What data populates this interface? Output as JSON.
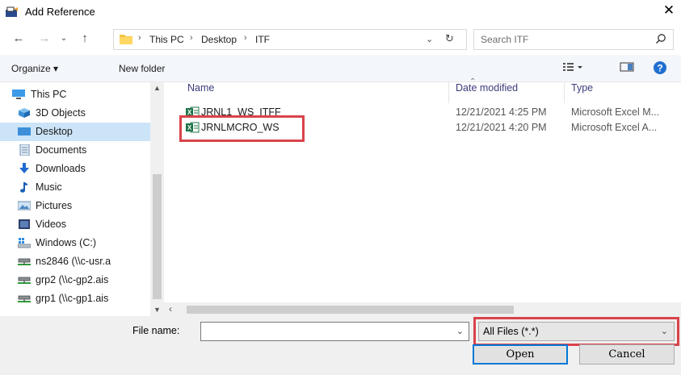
{
  "window": {
    "title": "Add Reference",
    "close": "✕"
  },
  "address": {
    "crumbs": [
      "This PC",
      "Desktop",
      "ITF"
    ],
    "search_placeholder": "Search ITF"
  },
  "toolbar": {
    "organize": "Organize ▾",
    "new_folder": "New folder"
  },
  "sidebar": {
    "items": [
      {
        "label": "This PC",
        "icon": "computer-icon"
      },
      {
        "label": "3D Objects",
        "icon": "3d-objects-icon"
      },
      {
        "label": "Desktop",
        "icon": "desktop-icon",
        "selected": true
      },
      {
        "label": "Documents",
        "icon": "documents-icon"
      },
      {
        "label": "Downloads",
        "icon": "downloads-icon"
      },
      {
        "label": "Music",
        "icon": "music-icon"
      },
      {
        "label": "Pictures",
        "icon": "pictures-icon"
      },
      {
        "label": "Videos",
        "icon": "videos-icon"
      },
      {
        "label": "Windows (C:)",
        "icon": "drive-icon"
      },
      {
        "label": "ns2846 (\\\\c-usr.a",
        "icon": "network-drive-icon"
      },
      {
        "label": "grp2 (\\\\c-gp2.ais",
        "icon": "network-drive-icon"
      },
      {
        "label": "grp1 (\\\\c-gp1.ais",
        "icon": "network-drive-icon"
      }
    ]
  },
  "columns": {
    "name": "Name",
    "date": "Date modified",
    "type": "Type"
  },
  "files": [
    {
      "name": "JRNL1_WS_ITFF",
      "date": "12/21/2021 4:25 PM",
      "type": "Microsoft Excel M..."
    },
    {
      "name": "JRNLMCRO_WS",
      "date": "12/21/2021 4:20 PM",
      "type": "Microsoft Excel A..."
    }
  ],
  "footer": {
    "file_name_label": "File name:",
    "file_name_value": "",
    "filter": "All Files (*.*)",
    "open": "Open",
    "cancel": "Cancel"
  },
  "colors": {
    "selection": "#cce4f7",
    "highlight": "#d9434a",
    "accent": "#0078d7",
    "excel": "#1d7346"
  }
}
